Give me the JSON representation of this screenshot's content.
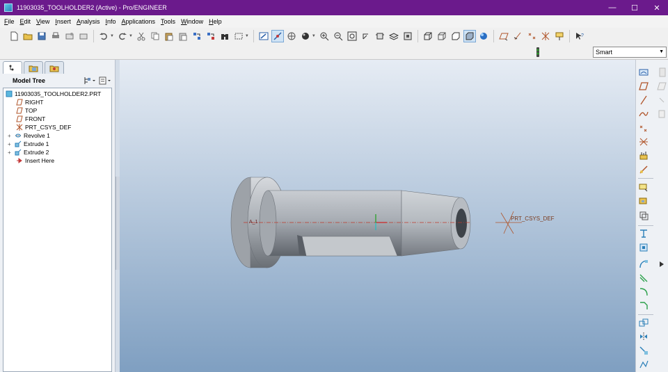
{
  "window": {
    "title": "11903035_TOOLHOLDER2 (Active) - Pro/ENGINEER",
    "minimize": "—",
    "maximize": "☐",
    "close": "✕"
  },
  "menu": [
    {
      "u": "F",
      "rest": "ile"
    },
    {
      "u": "E",
      "rest": "dit"
    },
    {
      "u": "V",
      "rest": "iew"
    },
    {
      "u": "I",
      "rest": "nsert"
    },
    {
      "u": "A",
      "rest": "nalysis"
    },
    {
      "u": "I",
      "rest": "nfo"
    },
    {
      "u": "A",
      "rest": "pplications"
    },
    {
      "u": "T",
      "rest": "ools"
    },
    {
      "u": "W",
      "rest": "indow"
    },
    {
      "u": "H",
      "rest": "elp"
    }
  ],
  "filter": {
    "value": "Smart"
  },
  "model_tree": {
    "title": "Model Tree",
    "root": "11903035_TOOLHOLDER2.PRT",
    "items": [
      {
        "label": "RIGHT",
        "expander": ""
      },
      {
        "label": "TOP",
        "expander": ""
      },
      {
        "label": "FRONT",
        "expander": ""
      },
      {
        "label": "PRT_CSYS_DEF",
        "expander": ""
      },
      {
        "label": "Revolve 1",
        "expander": "+"
      },
      {
        "label": "Extrude 1",
        "expander": "+"
      },
      {
        "label": "Extrude 2",
        "expander": "+"
      },
      {
        "label": "Insert Here",
        "expander": ""
      }
    ]
  },
  "graphics": {
    "csys_label": "PRT_CSYS_DEF",
    "axis_label": "A_1"
  },
  "colors": {
    "titlebar": "#6b1a8c",
    "part_grey": "#a8adb4",
    "datum_orange": "#b0552a",
    "axis_red": "#c0392b"
  }
}
